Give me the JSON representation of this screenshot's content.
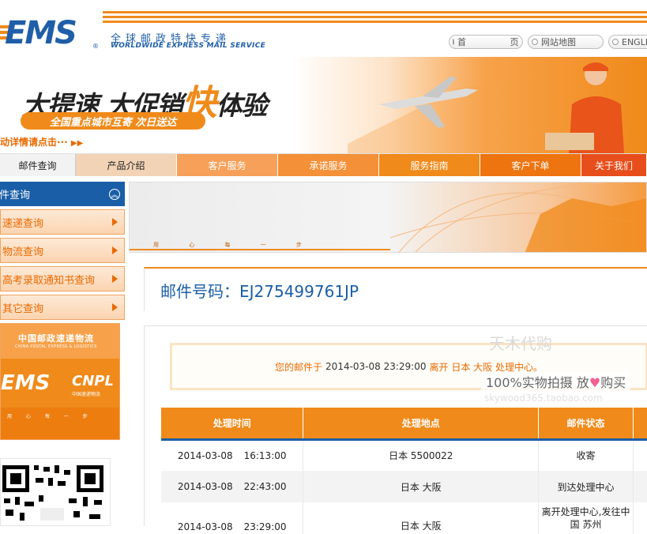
{
  "header": {
    "logo_text": "EMS",
    "brand_cn": "全球邮政特快专递",
    "brand_en": "WORLDWIDE EXPRESS MAIL SERVICE",
    "links": [
      {
        "label": "首 页"
      },
      {
        "label": "网站地图"
      },
      {
        "label": "ENGLI"
      }
    ]
  },
  "banner": {
    "title_part1": "大提速 大促销",
    "title_fast": "快",
    "title_part2": "体验",
    "subtitle": "全国重点城市互寄 次日送达",
    "detail_link": "动详情请点击···"
  },
  "nav": {
    "items": [
      {
        "label": "邮件查询"
      },
      {
        "label": "产品介绍"
      },
      {
        "label": "客户服务"
      },
      {
        "label": "承诺服务"
      },
      {
        "label": "服务指南"
      },
      {
        "label": "客户下单"
      },
      {
        "label": "关于我们"
      }
    ]
  },
  "sidebar": {
    "heading": "邮件查询",
    "items": [
      {
        "label": "速递查询"
      },
      {
        "label": "物流查询"
      },
      {
        "label": "高考录取通知书查询"
      },
      {
        "label": "其它查询"
      }
    ],
    "promo": {
      "cn": "中国邮政速递物流",
      "en": "CHINA POSTAL EXPRESS & LOGISTICS",
      "ems": "EMS",
      "cnpl": "CNPL",
      "cnpl_sub": "中国速递物流",
      "strip": "用 心 每 一 步"
    }
  },
  "main": {
    "banner_strip": "用 心 每 一 步",
    "mail_label": "邮件号码：EJ275499761JP",
    "status": {
      "prefix": "您的邮件于",
      "datetime": "2014-03-08 23:29:00",
      "suffix": "离开 日本 大阪 处理中心。"
    },
    "watermark": {
      "line1": "天木代购",
      "line2a": "100%实物拍摄",
      "line2b": "放",
      "line2c": "购买",
      "line3": "skywood365.taobao.com"
    },
    "table": {
      "headers": [
        "处理时间",
        "处理地点",
        "邮件状态"
      ],
      "rows": [
        {
          "date": "2014-03-08",
          "time": "16:13:00",
          "place": "日本 5500022",
          "status": "收寄"
        },
        {
          "date": "2014-03-08",
          "time": "22:43:00",
          "place": "日本 大阪",
          "status": "到达处理中心"
        },
        {
          "date": "2014-03-08",
          "time": "23:29:00",
          "place": "日本 大阪",
          "status": "离开处理中心,发往中国 苏州"
        }
      ]
    }
  },
  "colors": {
    "brand_orange": "#f08a1a",
    "brand_blue": "#1a5ea7"
  }
}
